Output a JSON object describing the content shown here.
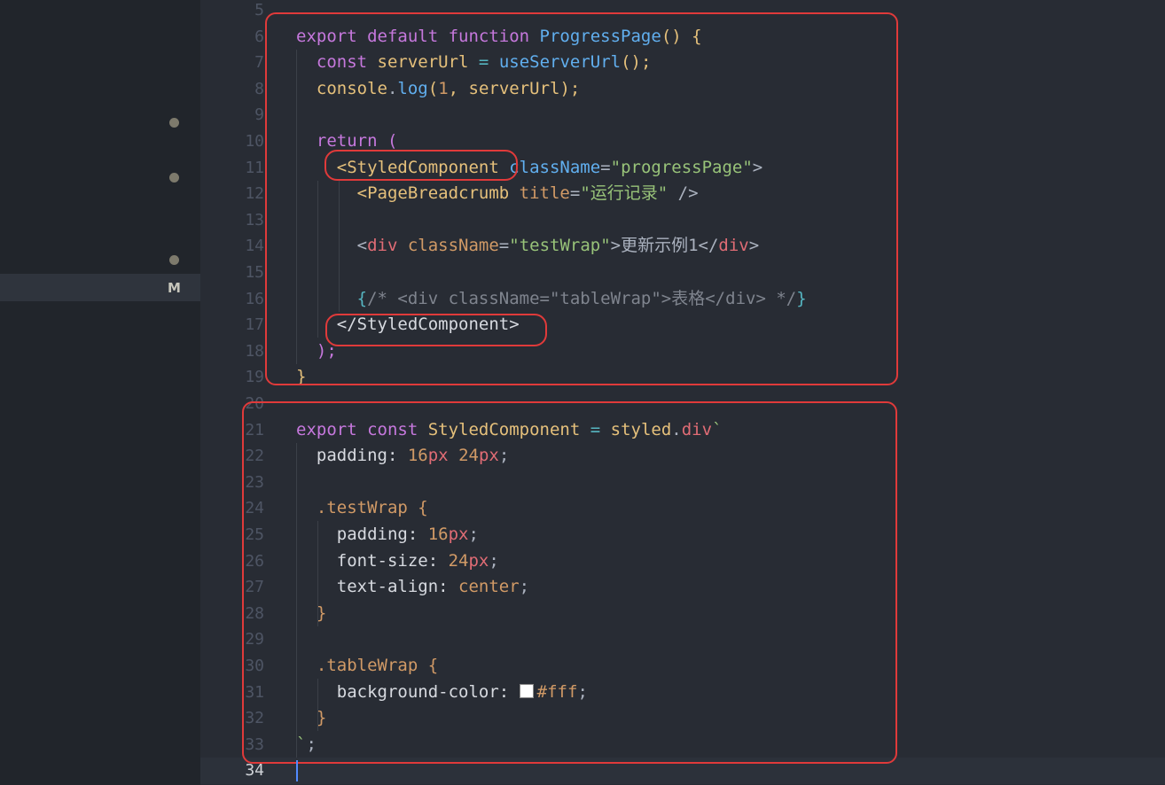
{
  "sidebar": {
    "git_status_badge": "M"
  },
  "editor": {
    "lines": [
      {
        "num": "5",
        "tokens": []
      },
      {
        "num": "6",
        "tokens": [
          {
            "t": "export ",
            "c": "kw"
          },
          {
            "t": "default ",
            "c": "kw"
          },
          {
            "t": "function ",
            "c": "kw"
          },
          {
            "t": "ProgressPage",
            "c": "fn"
          },
          {
            "t": "() {",
            "c": "id"
          }
        ]
      },
      {
        "num": "7",
        "tokens": [
          {
            "t": "  ",
            "c": "pl"
          },
          {
            "t": "const ",
            "c": "kw"
          },
          {
            "t": "serverUrl ",
            "c": "id"
          },
          {
            "t": "= ",
            "c": "op"
          },
          {
            "t": "useServerUrl",
            "c": "fn"
          },
          {
            "t": "();",
            "c": "id"
          }
        ]
      },
      {
        "num": "8",
        "tokens": [
          {
            "t": "  console",
            "c": "id"
          },
          {
            "t": ".",
            "c": "pl"
          },
          {
            "t": "log",
            "c": "fn"
          },
          {
            "t": "(",
            "c": "id"
          },
          {
            "t": "1",
            "c": "num"
          },
          {
            "t": ", serverUrl);",
            "c": "id"
          }
        ]
      },
      {
        "num": "9",
        "tokens": []
      },
      {
        "num": "10",
        "tokens": [
          {
            "t": "  return (",
            "c": "kw"
          }
        ]
      },
      {
        "num": "11",
        "tokens": [
          {
            "t": "    <StyledComponent ",
            "c": "id"
          },
          {
            "t": "className",
            "c": "fn"
          },
          {
            "t": "=",
            "c": "pl"
          },
          {
            "t": "\"progressPage\"",
            "c": "str"
          },
          {
            "t": ">",
            "c": "pl"
          }
        ]
      },
      {
        "num": "12",
        "tokens": [
          {
            "t": "      <PageBreadcrumb ",
            "c": "id"
          },
          {
            "t": "title",
            "c": "attr"
          },
          {
            "t": "=",
            "c": "pl"
          },
          {
            "t": "\"运行记录\"",
            "c": "str"
          },
          {
            "t": " />",
            "c": "pl"
          }
        ]
      },
      {
        "num": "13",
        "tokens": []
      },
      {
        "num": "14",
        "tokens": [
          {
            "t": "      <",
            "c": "pl"
          },
          {
            "t": "div ",
            "c": "tag"
          },
          {
            "t": "className",
            "c": "attr"
          },
          {
            "t": "=",
            "c": "pl"
          },
          {
            "t": "\"testWrap\"",
            "c": "str"
          },
          {
            "t": ">更新示例1</",
            "c": "pl"
          },
          {
            "t": "div",
            "c": "tag"
          },
          {
            "t": ">",
            "c": "pl"
          }
        ]
      },
      {
        "num": "15",
        "tokens": []
      },
      {
        "num": "16",
        "tokens": [
          {
            "t": "      {",
            "c": "op"
          },
          {
            "t": "/* <div className=\"tableWrap\">表格</div> */",
            "c": "cm"
          },
          {
            "t": "}",
            "c": "op"
          }
        ]
      },
      {
        "num": "17",
        "tokens": [
          {
            "t": "    </StyledComponent>",
            "c": "prop"
          }
        ]
      },
      {
        "num": "18",
        "tokens": [
          {
            "t": "  );",
            "c": "kw"
          }
        ]
      },
      {
        "num": "19",
        "tokens": [
          {
            "t": "}",
            "c": "id"
          }
        ]
      },
      {
        "num": "20",
        "tokens": []
      },
      {
        "num": "21",
        "tokens": [
          {
            "t": "export ",
            "c": "kw"
          },
          {
            "t": "const ",
            "c": "kw"
          },
          {
            "t": "StyledComponent ",
            "c": "id"
          },
          {
            "t": "= ",
            "c": "op"
          },
          {
            "t": "styled",
            "c": "id"
          },
          {
            "t": ".",
            "c": "pl"
          },
          {
            "t": "div",
            "c": "tag"
          },
          {
            "t": "`",
            "c": "str"
          }
        ]
      },
      {
        "num": "22",
        "tokens": [
          {
            "t": "  padding: ",
            "c": "prop"
          },
          {
            "t": "16",
            "c": "val"
          },
          {
            "t": "px ",
            "c": "unit"
          },
          {
            "t": "24",
            "c": "val"
          },
          {
            "t": "px",
            "c": "unit"
          },
          {
            "t": ";",
            "c": "punc"
          }
        ]
      },
      {
        "num": "23",
        "tokens": []
      },
      {
        "num": "24",
        "tokens": [
          {
            "t": "  .testWrap {",
            "c": "sel"
          }
        ]
      },
      {
        "num": "25",
        "tokens": [
          {
            "t": "    padding: ",
            "c": "prop"
          },
          {
            "t": "16",
            "c": "val"
          },
          {
            "t": "px",
            "c": "unit"
          },
          {
            "t": ";",
            "c": "punc"
          }
        ]
      },
      {
        "num": "26",
        "tokens": [
          {
            "t": "    font-size: ",
            "c": "prop"
          },
          {
            "t": "24",
            "c": "val"
          },
          {
            "t": "px",
            "c": "unit"
          },
          {
            "t": ";",
            "c": "punc"
          }
        ]
      },
      {
        "num": "27",
        "tokens": [
          {
            "t": "    text-align: ",
            "c": "prop"
          },
          {
            "t": "center",
            "c": "val"
          },
          {
            "t": ";",
            "c": "punc"
          }
        ]
      },
      {
        "num": "28",
        "tokens": [
          {
            "t": "  }",
            "c": "sel"
          }
        ]
      },
      {
        "num": "29",
        "tokens": []
      },
      {
        "num": "30",
        "tokens": [
          {
            "t": "  .tableWrap {",
            "c": "sel"
          }
        ]
      },
      {
        "num": "31",
        "tokens": [
          {
            "t": "    background-color: ",
            "c": "prop"
          },
          {
            "t": "",
            "c": "swatch"
          },
          {
            "t": "#fff",
            "c": "val"
          },
          {
            "t": ";",
            "c": "punc"
          }
        ]
      },
      {
        "num": "32",
        "tokens": [
          {
            "t": "  }",
            "c": "sel"
          }
        ]
      },
      {
        "num": "33",
        "tokens": [
          {
            "t": "`",
            "c": "str"
          },
          {
            "t": ";",
            "c": "punc"
          }
        ]
      },
      {
        "num": "34",
        "tokens": [],
        "current": true
      }
    ]
  },
  "colors": {
    "highlight_box": "#e03a3a",
    "editor_bg": "#282c34",
    "sidebar_bg": "#21252b"
  }
}
